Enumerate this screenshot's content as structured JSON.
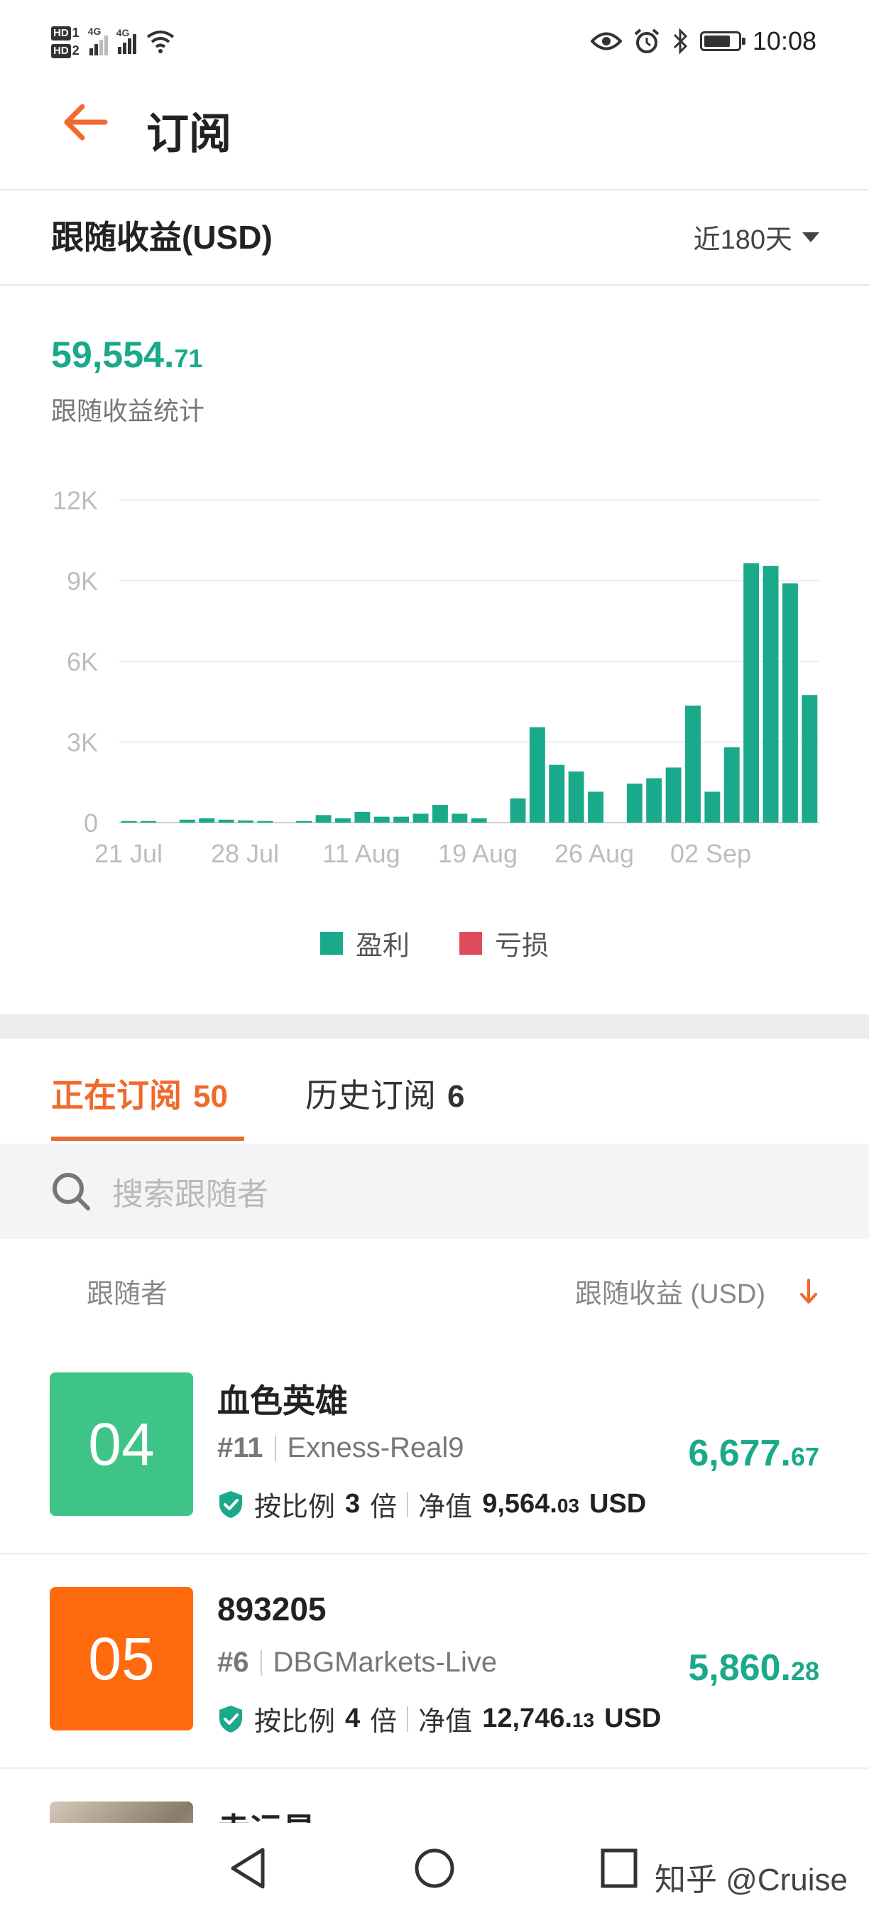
{
  "status_bar": {
    "time": "10:08",
    "sim1_label": "HD",
    "sim1_num": "1",
    "sim2_label": "HD",
    "sim2_num": "2",
    "network1": "4G",
    "network2": "4G"
  },
  "header": {
    "title": "订阅"
  },
  "earnings": {
    "title": "跟随收益(USD)",
    "period": "近180天",
    "total_int": "59,554.",
    "total_dec": "71",
    "total_label": "跟随收益统计"
  },
  "chart_data": {
    "type": "bar",
    "y_ticks": [
      "12K",
      "9K",
      "6K",
      "3K",
      "0"
    ],
    "ylim": [
      0,
      12000
    ],
    "x_ticks": [
      "21 Jul",
      "28 Jul",
      "11 Aug",
      "19 Aug",
      "26 Aug",
      "02 Sep"
    ],
    "series": [
      {
        "name": "盈利",
        "color": "#1aa98a",
        "values": [
          60,
          60,
          0,
          110,
          160,
          110,
          80,
          60,
          0,
          60,
          280,
          160,
          400,
          220,
          220,
          330,
          660,
          330,
          160,
          0,
          900,
          3550,
          2150,
          1900,
          1150,
          0,
          1450,
          1650,
          2050,
          4350,
          1150,
          2800,
          9650,
          9550,
          8900,
          4750
        ]
      },
      {
        "name": "亏损",
        "color": "#e04b5c",
        "values": []
      }
    ],
    "legend": [
      "盈利",
      "亏损"
    ]
  },
  "tabs": [
    {
      "label": "正在订阅",
      "count": "50"
    },
    {
      "label": "历史订阅",
      "count": "6"
    }
  ],
  "search": {
    "placeholder": "搜索跟随者"
  },
  "list_header": {
    "left": "跟随者",
    "right": "跟随收益 (USD)"
  },
  "rows": [
    {
      "avatar_text": "04",
      "avatar_color": "#3ec487",
      "name": "血色英雄",
      "rank": "#11",
      "broker": "Exness-Real9",
      "ratio_prefix": "按比例",
      "ratio_value": "3",
      "ratio_suffix": "倍",
      "equity_label": "净值",
      "equity_int": "9,564.",
      "equity_dec": "03",
      "equity_unit": "USD",
      "value_int": "6,677.",
      "value_dec": "67"
    },
    {
      "avatar_text": "05",
      "avatar_color": "#ff6a0f",
      "name": "893205",
      "rank": "#6",
      "broker": "DBGMarkets-Live",
      "ratio_prefix": "按比例",
      "ratio_value": "4",
      "ratio_suffix": "倍",
      "equity_label": "净值",
      "equity_int": "12,746.",
      "equity_dec": "13",
      "equity_unit": "USD",
      "value_int": "5,860.",
      "value_dec": "28"
    },
    {
      "name": "幸运星"
    }
  ],
  "watermark": "知乎 @Cruise"
}
